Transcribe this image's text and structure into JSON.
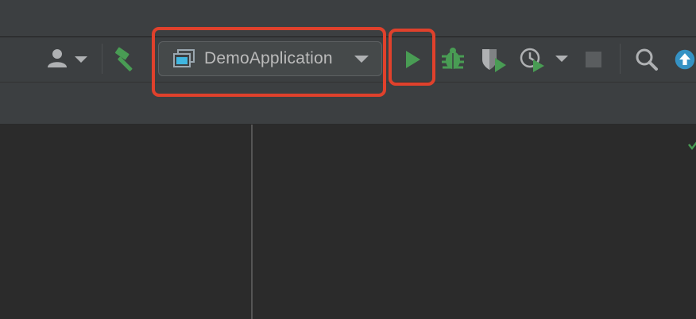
{
  "toolbar": {
    "run_configuration": {
      "selected_value": "DemoApplication"
    },
    "icons": {
      "user": "user-icon",
      "user_dropdown": "chevron-down-icon",
      "build": "hammer-icon",
      "config_app": "application-window-icon",
      "config_dropdown": "chevron-down-icon",
      "run": "play-icon",
      "debug": "bug-icon",
      "coverage": "coverage-shield-icon",
      "profile": "profiler-clock-icon",
      "profile_dropdown": "chevron-down-icon",
      "stop": "stop-icon",
      "search": "search-icon",
      "update": "arrow-up-circle-icon"
    }
  },
  "colors": {
    "accent_green": "#499c54",
    "highlight_red": "#e0412c",
    "update_blue": "#3592c4",
    "toolbar_bg": "#3c3f41",
    "editor_bg": "#2b2b2b"
  }
}
